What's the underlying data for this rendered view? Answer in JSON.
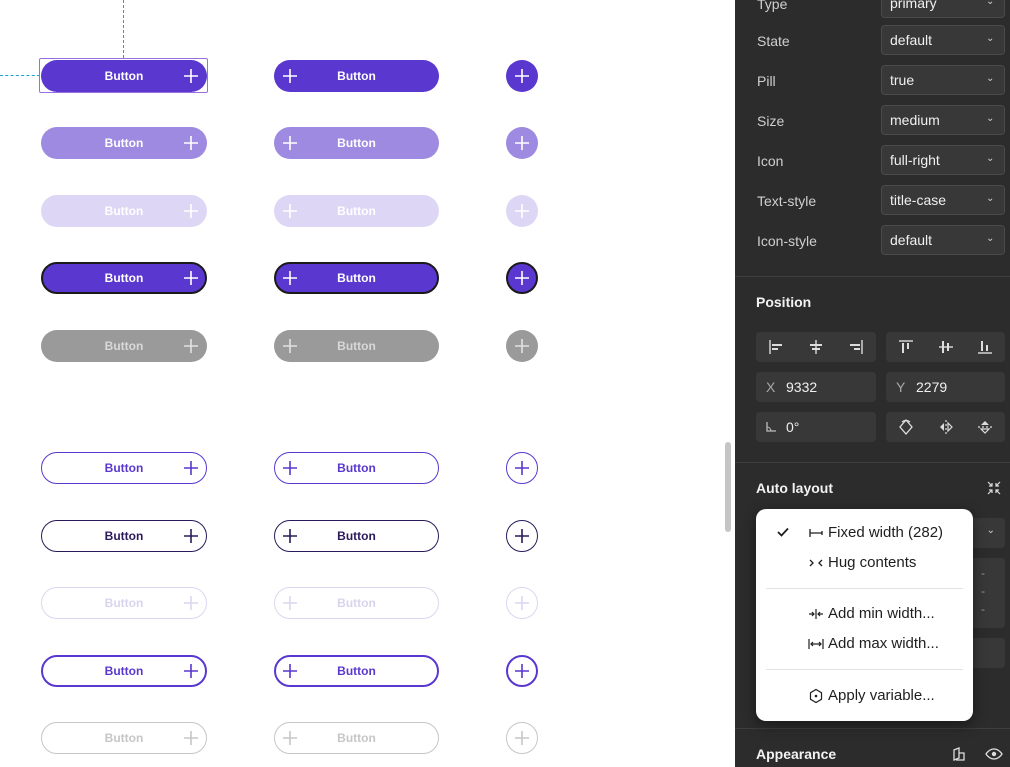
{
  "canvas": {
    "button_label": "Button",
    "rows_top": [
      "primary",
      "hover",
      "disabled",
      "focus",
      "gray"
    ],
    "rows_bottom": [
      "outline",
      "outline-dark",
      "outline-disabled",
      "outline-thick",
      "outline-gray"
    ]
  },
  "properties": {
    "type": {
      "label": "Type",
      "value": "primary"
    },
    "state": {
      "label": "State",
      "value": "default"
    },
    "pill": {
      "label": "Pill",
      "value": "true"
    },
    "size": {
      "label": "Size",
      "value": "medium"
    },
    "icon": {
      "label": "Icon",
      "value": "full-right"
    },
    "text_style": {
      "label": "Text-style",
      "value": "title-case"
    },
    "icon_style": {
      "label": "Icon-style",
      "value": "default"
    }
  },
  "position": {
    "title": "Position",
    "x_label": "X",
    "x_value": "9332",
    "y_label": "Y",
    "y_value": "2279",
    "rotation": "0°"
  },
  "auto_layout": {
    "title": "Auto layout"
  },
  "appearance": {
    "title": "Appearance"
  },
  "menu": {
    "fixed_width": "Fixed width (282)",
    "hug_contents": "Hug contents",
    "add_min_width": "Add min width...",
    "add_max_width": "Add max width...",
    "apply_variable": "Apply variable..."
  },
  "colors": {
    "accent": "#5a37cf",
    "panel_bg": "#2c2c2c",
    "guide": "#1fa2d6"
  }
}
